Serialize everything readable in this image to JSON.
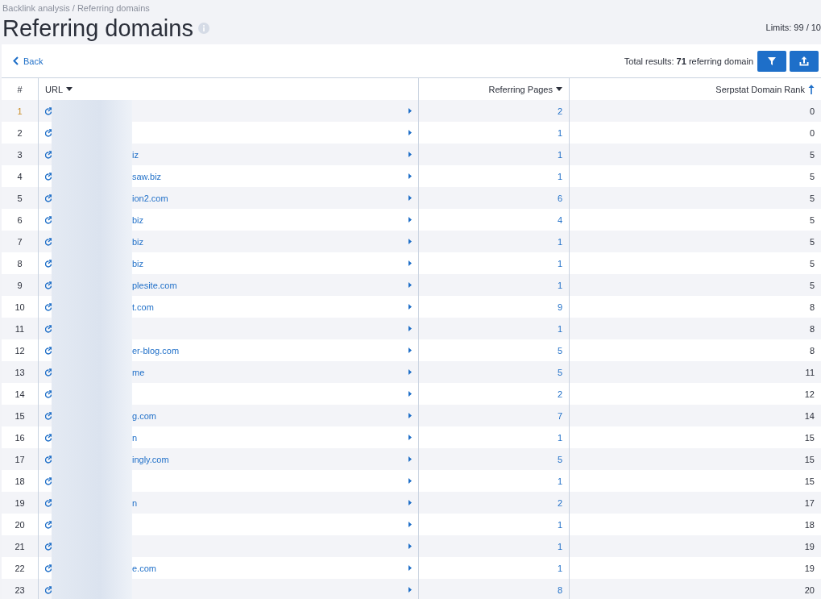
{
  "breadcrumb": "Backlink analysis / Referring domains",
  "title": "Referring domains",
  "limits": "Limits: 99 / 10",
  "toolbar": {
    "back": "Back",
    "total_prefix": "Total results: ",
    "total_count": "71",
    "total_suffix": " referring domain"
  },
  "table": {
    "columns": [
      {
        "label": "#",
        "kind": "plain"
      },
      {
        "label": "URL",
        "kind": "menu"
      },
      {
        "label": "Referring Pages",
        "kind": "menu"
      },
      {
        "label": "Serpstat Domain Rank",
        "kind": "sorted"
      }
    ],
    "rows": [
      {
        "index": "1",
        "highlighted": true,
        "url": "",
        "pages": "2",
        "rank": "0"
      },
      {
        "index": "2",
        "highlighted": false,
        "url": "",
        "pages": "1",
        "rank": "0"
      },
      {
        "index": "3",
        "highlighted": false,
        "url": "iz",
        "pages": "1",
        "rank": "5"
      },
      {
        "index": "4",
        "highlighted": false,
        "url": "saw.biz",
        "pages": "1",
        "rank": "5"
      },
      {
        "index": "5",
        "highlighted": false,
        "url": "ion2.com",
        "pages": "6",
        "rank": "5"
      },
      {
        "index": "6",
        "highlighted": false,
        "url": "biz",
        "pages": "4",
        "rank": "5"
      },
      {
        "index": "7",
        "highlighted": false,
        "url": "biz",
        "pages": "1",
        "rank": "5"
      },
      {
        "index": "8",
        "highlighted": false,
        "url": "biz",
        "pages": "1",
        "rank": "5"
      },
      {
        "index": "9",
        "highlighted": false,
        "url": "plesite.com",
        "pages": "1",
        "rank": "5"
      },
      {
        "index": "10",
        "highlighted": false,
        "url": "t.com",
        "pages": "9",
        "rank": "8"
      },
      {
        "index": "11",
        "highlighted": false,
        "url": "",
        "pages": "1",
        "rank": "8"
      },
      {
        "index": "12",
        "highlighted": false,
        "url": "er-blog.com",
        "pages": "5",
        "rank": "8"
      },
      {
        "index": "13",
        "highlighted": false,
        "url": "me",
        "pages": "5",
        "rank": "11"
      },
      {
        "index": "14",
        "highlighted": false,
        "url": "",
        "pages": "2",
        "rank": "12"
      },
      {
        "index": "15",
        "highlighted": false,
        "url": "g.com",
        "pages": "7",
        "rank": "14"
      },
      {
        "index": "16",
        "highlighted": false,
        "url": "n",
        "pages": "1",
        "rank": "15"
      },
      {
        "index": "17",
        "highlighted": false,
        "url": "ingly.com",
        "pages": "5",
        "rank": "15"
      },
      {
        "index": "18",
        "highlighted": false,
        "url": "",
        "pages": "1",
        "rank": "15"
      },
      {
        "index": "19",
        "highlighted": false,
        "url": "n",
        "pages": "2",
        "rank": "17"
      },
      {
        "index": "20",
        "highlighted": false,
        "url": "",
        "pages": "1",
        "rank": "18"
      },
      {
        "index": "21",
        "highlighted": false,
        "url": "",
        "pages": "1",
        "rank": "19"
      },
      {
        "index": "22",
        "highlighted": false,
        "url": "e.com",
        "pages": "1",
        "rank": "19"
      },
      {
        "index": "23",
        "highlighted": false,
        "url": "",
        "pages": "8",
        "rank": "20"
      }
    ]
  }
}
